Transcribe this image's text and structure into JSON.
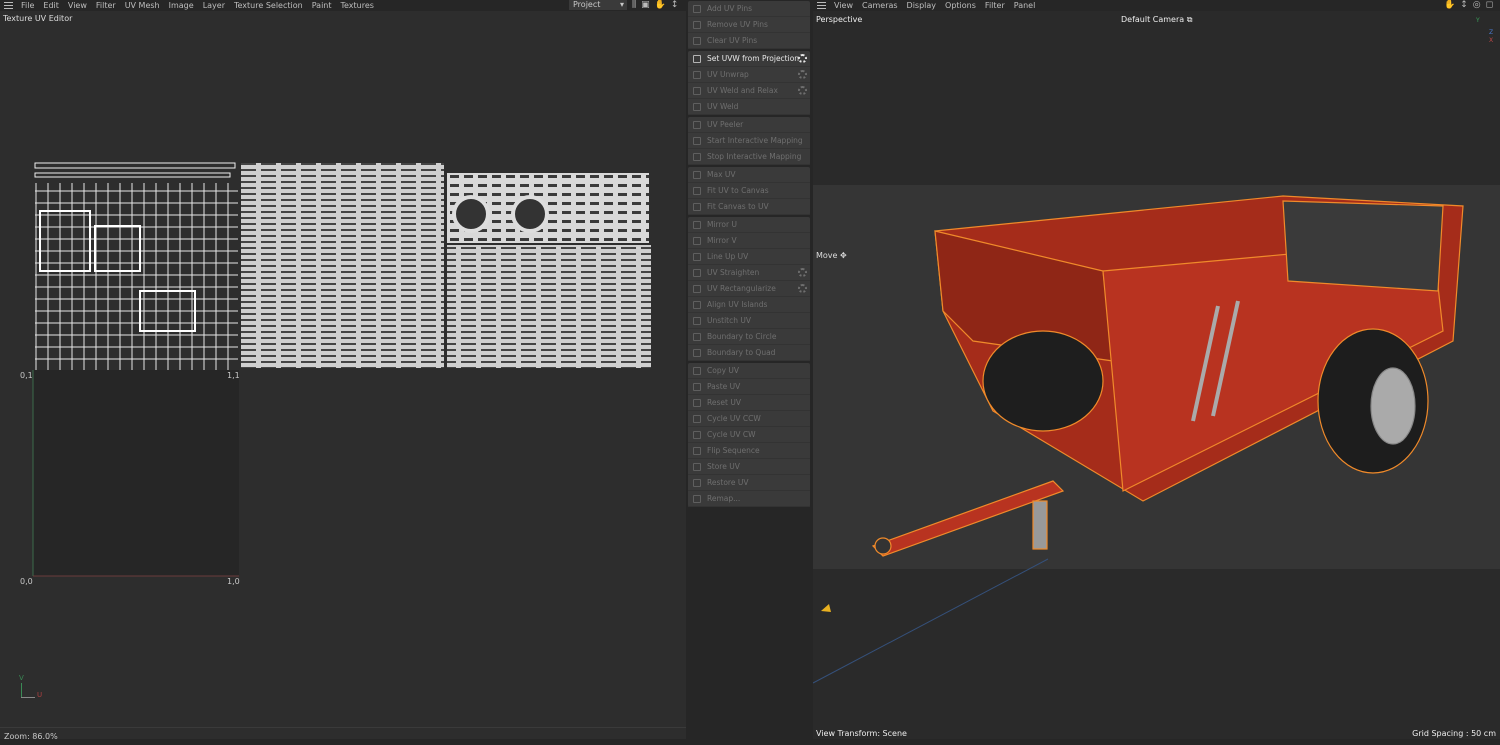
{
  "left_menu": [
    "File",
    "Edit",
    "View",
    "Filter",
    "UV Mesh",
    "Image",
    "Layer",
    "Texture Selection",
    "Paint",
    "Textures"
  ],
  "project_select": "Project",
  "panel_title": "Texture UV Editor",
  "uv_labels": {
    "tl": "0,1",
    "tr": "1,1",
    "bl": "0,0",
    "br": "1,0"
  },
  "axis": {
    "v": "V",
    "u": "U"
  },
  "zoom": "Zoom: 86.0%",
  "commands": [
    [
      {
        "label": "Add UV Pins"
      },
      {
        "label": "Remove UV Pins"
      },
      {
        "label": "Clear UV Pins"
      }
    ],
    [
      {
        "label": "Set UVW from Projection",
        "active": true,
        "gear": true
      },
      {
        "label": "UV Unwrap",
        "gear": true
      },
      {
        "label": "UV Weld and Relax",
        "gear": true
      },
      {
        "label": "UV Weld"
      }
    ],
    [
      {
        "label": "UV Peeler"
      },
      {
        "label": "Start Interactive Mapping"
      },
      {
        "label": "Stop Interactive Mapping"
      }
    ],
    [
      {
        "label": "Max UV"
      },
      {
        "label": "Fit UV to Canvas"
      },
      {
        "label": "Fit Canvas to UV"
      }
    ],
    [
      {
        "label": "Mirror U"
      },
      {
        "label": "Mirror V"
      },
      {
        "label": "Line Up UV"
      },
      {
        "label": "UV Straighten",
        "gear": true
      },
      {
        "label": "UV Rectangularize",
        "gear": true
      },
      {
        "label": "Align UV Islands"
      },
      {
        "label": "Unstitch UV"
      },
      {
        "label": "Boundary to Circle"
      },
      {
        "label": "Boundary to Quad"
      }
    ],
    [
      {
        "label": "Copy UV"
      },
      {
        "label": "Paste UV"
      },
      {
        "label": "Reset UV"
      },
      {
        "label": "Cycle UV CCW"
      },
      {
        "label": "Cycle UV CW"
      },
      {
        "label": "Flip Sequence"
      },
      {
        "label": "Store UV"
      },
      {
        "label": "Restore UV"
      },
      {
        "label": "Remap..."
      }
    ]
  ],
  "right_menu": [
    "View",
    "Cameras",
    "Display",
    "Options",
    "Filter",
    "Panel"
  ],
  "viewport": {
    "projection": "Perspective",
    "camera": "Default Camera",
    "tool": "Move",
    "view_transform": "View Transform: Scene",
    "grid_spacing": "Grid Spacing : 50 cm",
    "axis": {
      "x": "X",
      "y": "Y",
      "z": "Z"
    }
  },
  "colors": {
    "model": "#b8321e",
    "selection": "#f08a2a"
  }
}
